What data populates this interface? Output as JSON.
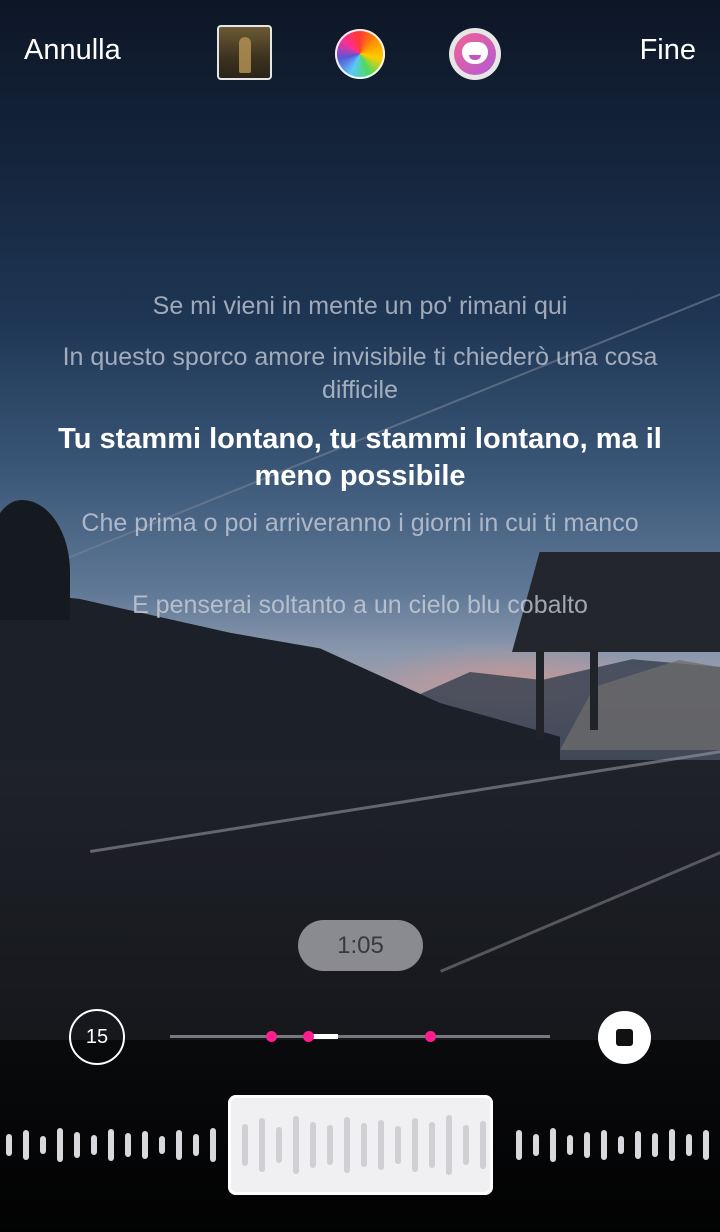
{
  "header": {
    "cancel_label": "Annulla",
    "done_label": "Fine",
    "album_thumb_icon": "album-cover",
    "color_picker_icon": "color-wheel-icon",
    "style_icon": "lyrics-style-icon"
  },
  "lyrics": [
    {
      "text": "Se mi vieni in mente un po' rimani qui",
      "active": false
    },
    {
      "text": "In questo sporco amore invisibile ti chiederò una cosa difficile",
      "active": false
    },
    {
      "text": "Tu stammi lontano, tu stammi lontano, ma il meno possibile",
      "active": true
    },
    {
      "text": "Che prima o poi arriveranno i giorni in cui ti manco",
      "active": false
    },
    {
      "text": "E penserai soltanto a un cielo blu cobalto",
      "active": false
    }
  ],
  "player": {
    "current_time": "1:05",
    "skip_label": "15",
    "skip_icon": "skip-15-icon",
    "stop_icon": "stop-icon",
    "accent_color": "#ff1d8f"
  }
}
